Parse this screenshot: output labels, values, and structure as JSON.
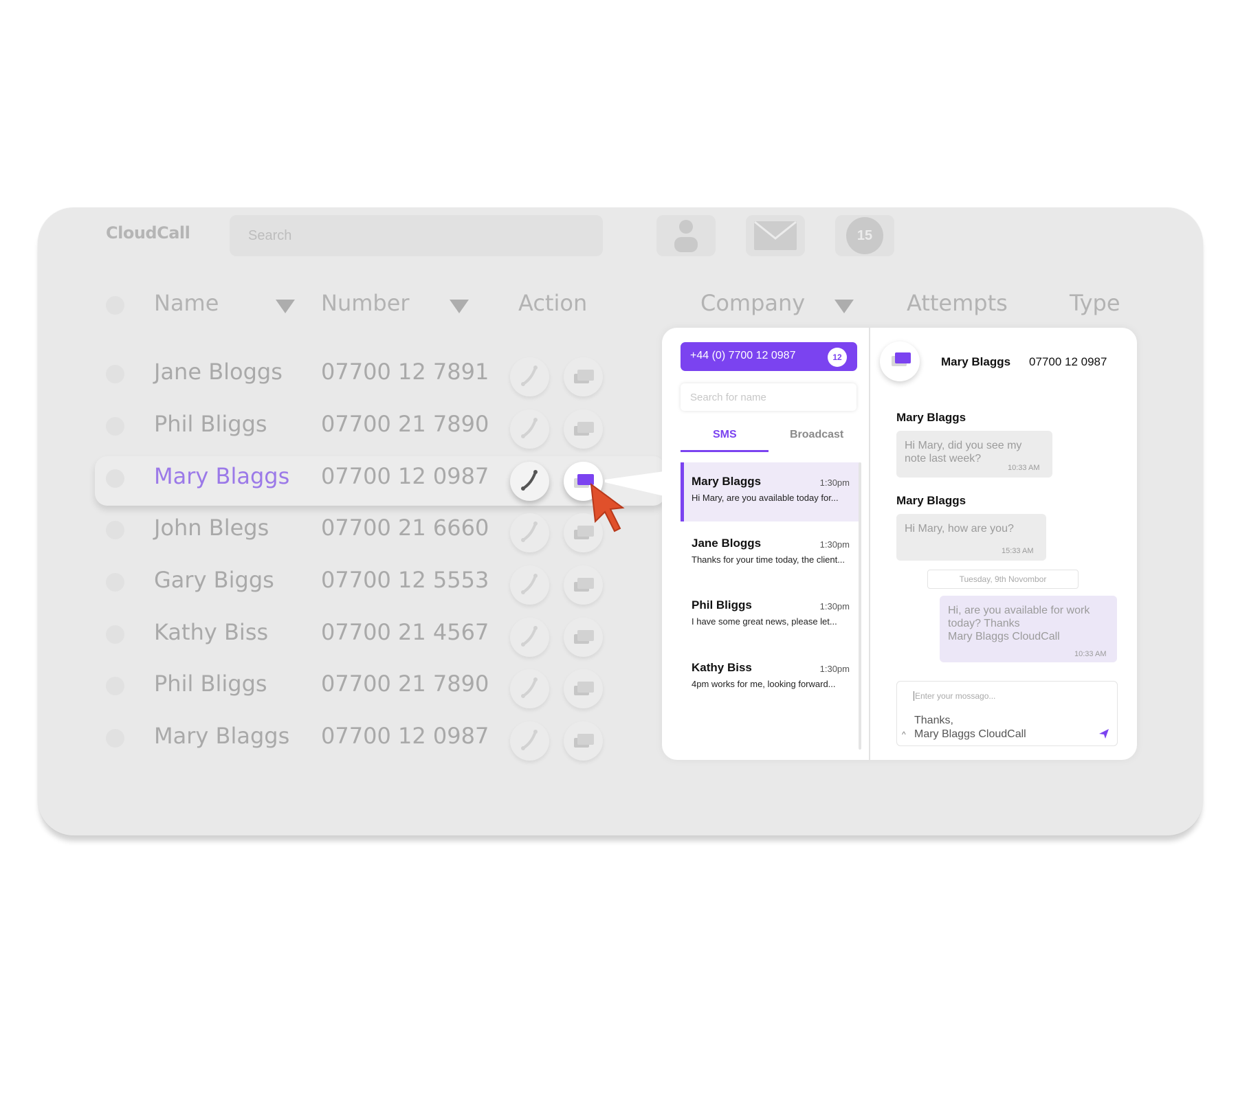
{
  "app": {
    "logo": "CloudCall",
    "search_placeholder": "Search",
    "notifications_count": "15"
  },
  "table": {
    "headers": {
      "name": "Name",
      "number": "Number",
      "action": "Action",
      "company": "Company",
      "attempts": "Attempts",
      "type": "Type"
    },
    "rows": [
      {
        "name": "Jane Bloggs",
        "number": "07700 12 7891"
      },
      {
        "name": "Phil Bliggs",
        "number": "07700 21 7890"
      },
      {
        "name": "Mary Blaggs",
        "number": "07700 12 0987"
      },
      {
        "name": "John Blegs",
        "number": "07700 21 6660"
      },
      {
        "name": "Gary Biggs",
        "number": "07700 12 5553"
      },
      {
        "name": "Kathy Biss",
        "number": "07700 21 4567"
      },
      {
        "name": "Phil Bliggs",
        "number": "07700 21 7890"
      },
      {
        "name": "Mary Blaggs",
        "number": "07700 12 0987"
      }
    ],
    "selected_index": 2
  },
  "sms_panel": {
    "phone_number": "+44 (0) 7700 12 0987",
    "unread_count": "12",
    "search_placeholder": "Search for name",
    "tabs": [
      "SMS",
      "Broadcast"
    ],
    "active_tab": "SMS",
    "conversations": [
      {
        "name": "Mary Blaggs",
        "time": "1:30pm",
        "preview": "Hi Mary, are you available today for..."
      },
      {
        "name": "Jane Bloggs",
        "time": "1:30pm",
        "preview": "Thanks for your time today, the client..."
      },
      {
        "name": "Phil Bliggs",
        "time": "1:30pm",
        "preview": "I have some great news, please let..."
      },
      {
        "name": "Kathy Biss",
        "time": "1:30pm",
        "preview": "4pm works for me, looking forward..."
      }
    ]
  },
  "chat": {
    "contact_name": "Mary Blaggs",
    "contact_number": "07700 12 0987",
    "messages": [
      {
        "sender": "Mary Blaggs",
        "text1": "Hi Mary, did you see my",
        "text2": "note last week?",
        "time": "10:33 AM"
      },
      {
        "sender": "Mary Blaggs",
        "text1": "Hi Mary, how are you?",
        "time": "15:33 AM"
      }
    ],
    "date_separator": "Tuesday, 9th Novombor",
    "outgoing": {
      "line1": "Hi, are you available for work",
      "line2": "today? Thanks",
      "line3": "Mary Blaggs CloudCall",
      "time": "10:33 AM"
    },
    "compose_placeholder": "Enter your mossago...",
    "signature_line1": "Thanks,",
    "signature_line2": "Mary Blaggs CloudCall"
  },
  "colors": {
    "accent": "#7b43f0",
    "cursor": "#e0502b",
    "selected_name": "#9b79e8"
  }
}
